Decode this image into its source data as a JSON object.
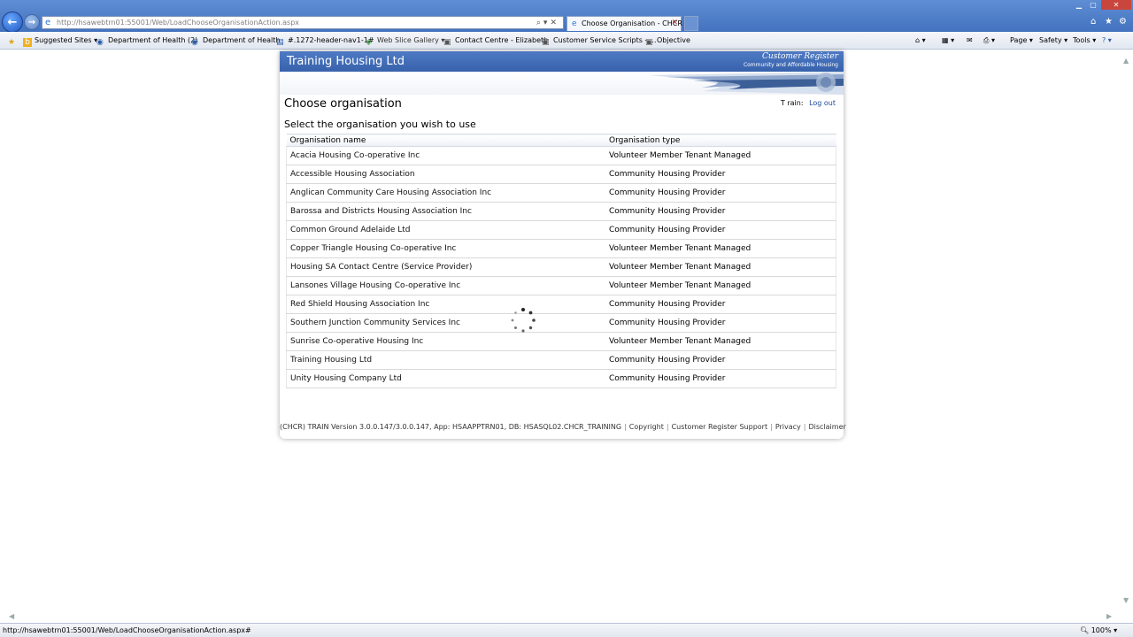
{
  "browser": {
    "address_url": "http://hsawebtrn01:55001/Web/LoadChooseOrganisationAction.aspx",
    "tab_title": "Choose Organisation - CHCR",
    "favorites": [
      {
        "label": "Suggested Sites ▾"
      },
      {
        "label": "Department of Health (2)"
      },
      {
        "label": "Department of Health"
      },
      {
        "label": "#.1272-header-nav1-1#"
      },
      {
        "label": "Web Slice Gallery ▾"
      },
      {
        "label": "Contact Centre - Elizabeth"
      },
      {
        "label": "Customer Service Scripts - ..."
      },
      {
        "label": "Objective"
      }
    ],
    "commands": {
      "page": "Page ▾",
      "safety": "Safety ▾",
      "tools": "Tools ▾"
    },
    "status_text": "http://hsawebtrn01:55001/Web/LoadChooseOrganisationAction.aspx#",
    "zoom": "100%",
    "colors": {
      "chrome_blue": "#4a7acb",
      "close_red": "#c9463d"
    }
  },
  "site": {
    "title": "Training Housing Ltd",
    "brand_title": "Customer Register",
    "brand_subtitle": "Community and Affordable Housing",
    "accent": "#3e68b2"
  },
  "main": {
    "heading": "Choose organisation",
    "user_name": "T rain:",
    "logout_label": "Log out",
    "subheading": "Select the organisation you wish to use",
    "table": {
      "headers": [
        "Organisation name",
        "Organisation type"
      ],
      "rows": [
        [
          "Acacia Housing Co-operative Inc",
          "Volunteer Member Tenant Managed"
        ],
        [
          "Accessible Housing Association",
          "Community Housing Provider"
        ],
        [
          "Anglican Community Care Housing Association Inc",
          "Community Housing Provider"
        ],
        [
          "Barossa and Districts Housing Association Inc",
          "Community Housing Provider"
        ],
        [
          "Common Ground Adelaide Ltd",
          "Community Housing Provider"
        ],
        [
          "Copper Triangle Housing Co-operative Inc",
          "Volunteer Member Tenant Managed"
        ],
        [
          "Housing SA Contact Centre (Service Provider)",
          "Volunteer Member Tenant Managed"
        ],
        [
          "Lansones Village Housing Co-operative Inc",
          "Volunteer Member Tenant Managed"
        ],
        [
          "Red Shield Housing Association Inc",
          "Community Housing Provider"
        ],
        [
          "Southern Junction Community Services Inc",
          "Community Housing Provider"
        ],
        [
          "Sunrise Co-operative Housing Inc",
          "Volunteer Member Tenant Managed"
        ],
        [
          "Training Housing Ltd",
          "Community Housing Provider"
        ],
        [
          "Unity Housing Company Ltd",
          "Community Housing Provider"
        ]
      ]
    },
    "loading_icon": "spinner-icon"
  },
  "footer": {
    "version": "(CHCR) TRAIN Version 3.0.0.147/3.0.0.147, App: HSAAPPTRN01, DB: HSASQL02.CHCR_TRAINING",
    "links": [
      "Copyright",
      "Customer Register Support",
      "Privacy",
      "Disclaimer"
    ]
  }
}
